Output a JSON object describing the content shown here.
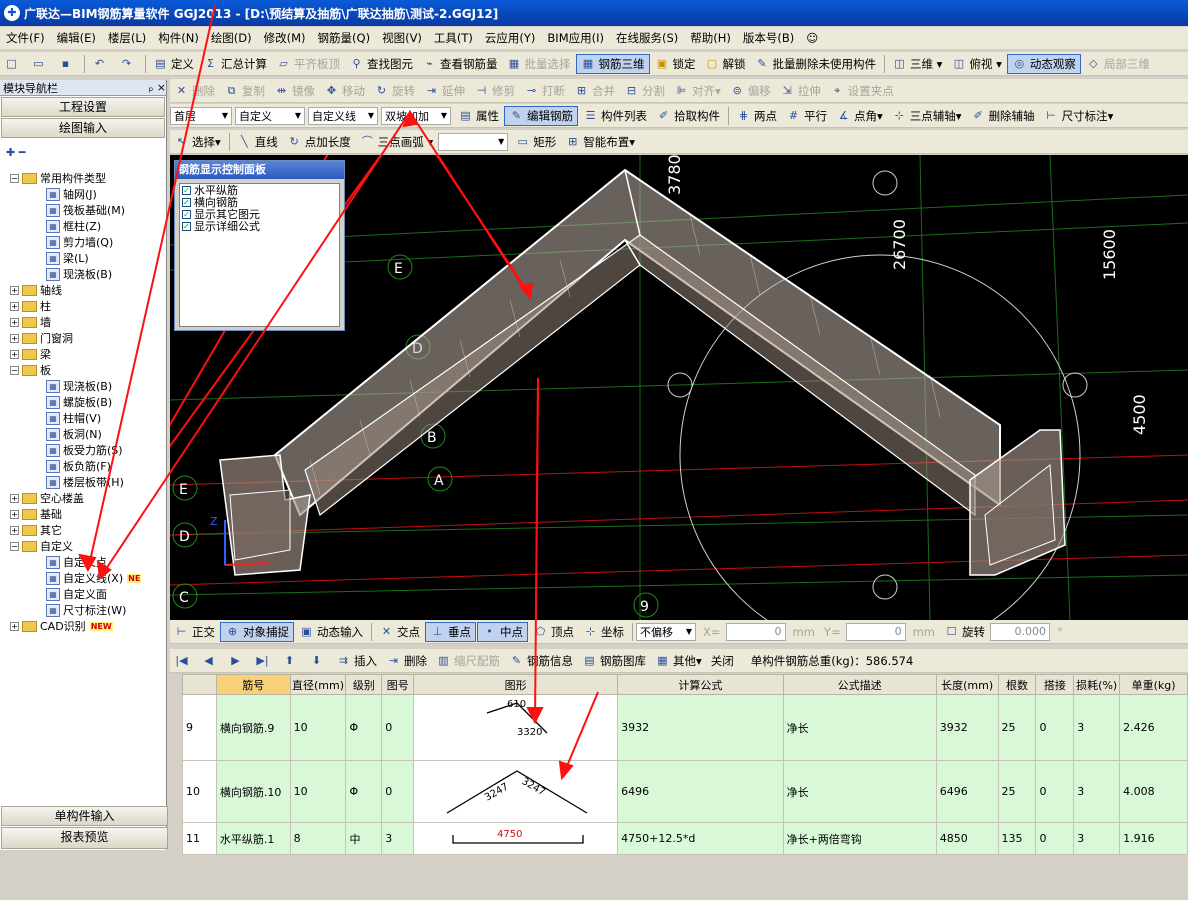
{
  "window": {
    "title": "广联达—BIM钢筋算量软件 GGJ2013 - [D:\\预结算及抽筋\\广联达抽筋\\测试-2.GGJ12]"
  },
  "menu": [
    "文件(F)",
    "编辑(E)",
    "楼层(L)",
    "构件(N)",
    "绘图(D)",
    "修改(M)",
    "钢筋量(Q)",
    "视图(V)",
    "工具(T)",
    "云应用(Y)",
    "BIM应用(I)",
    "在线服务(S)",
    "帮助(H)",
    "版本号(B)"
  ],
  "toolbar1": {
    "define": "定义",
    "sum": "汇总计算",
    "flat_top": "平齐板顶",
    "find": "查找图元",
    "view_rebar": "查看钢筋量",
    "batch_select": "批量选择",
    "rebar3d": "钢筋三维",
    "lock": "锁定",
    "unlock": "解锁",
    "batch_delete": "批量删除未使用构件",
    "view3d": "三维",
    "top_view": "俯视",
    "dynamic": "动态观察",
    "local3d": "局部三维"
  },
  "toolbar2": [
    "删除",
    "复制",
    "镜像",
    "移动",
    "旋转",
    "延伸",
    "修剪",
    "打断",
    "合并",
    "分割",
    "对齐",
    "偏移",
    "拉伸",
    "设置夹点"
  ],
  "toolbar3": {
    "floor": "首层",
    "custom": "自定义",
    "custom_line": "自定义线",
    "double_slope": "双坡加加",
    "props": "属性",
    "edit_rebar": "编辑钢筋",
    "component_list": "构件列表",
    "pick": "拾取构件",
    "two_point": "两点",
    "parallel": "平行",
    "angle": "点角",
    "three_aux": "三点辅轴",
    "del_aux": "删除辅轴",
    "dim": "尺寸标注"
  },
  "toolbar4": {
    "select": "选择",
    "line": "直线",
    "point_len": "点加长度",
    "arc": "三点画弧",
    "rect": "矩形",
    "smart": "智能布置"
  },
  "nav": {
    "title": "模块导航栏",
    "pin": "ₚ ×",
    "btn_project": "工程设置",
    "btn_draw": "绘图输入",
    "tree": [
      {
        "label": "常用构件类型",
        "level": 0,
        "expanded": true,
        "folder": true
      },
      {
        "label": "轴网(J)",
        "level": 2,
        "icon": "grid"
      },
      {
        "label": "筏板基础(M)",
        "level": 2,
        "icon": "raft"
      },
      {
        "label": "框柱(Z)",
        "level": 2,
        "icon": "column"
      },
      {
        "label": "剪力墙(Q)",
        "level": 2,
        "icon": "wall"
      },
      {
        "label": "梁(L)",
        "level": 2,
        "icon": "beam"
      },
      {
        "label": "现浇板(B)",
        "level": 2,
        "icon": "slab"
      },
      {
        "label": "轴线",
        "level": 0,
        "expanded": false,
        "folder": true
      },
      {
        "label": "柱",
        "level": 0,
        "expanded": false,
        "folder": true
      },
      {
        "label": "墙",
        "level": 0,
        "expanded": false,
        "folder": true
      },
      {
        "label": "门窗洞",
        "level": 0,
        "expanded": false,
        "folder": true
      },
      {
        "label": "梁",
        "level": 0,
        "expanded": false,
        "folder": true
      },
      {
        "label": "板",
        "level": 0,
        "expanded": true,
        "folder": true
      },
      {
        "label": "现浇板(B)",
        "level": 2,
        "icon": "slab"
      },
      {
        "label": "螺旋板(B)",
        "level": 2,
        "icon": "spiral"
      },
      {
        "label": "柱帽(V)",
        "level": 2,
        "icon": "cap"
      },
      {
        "label": "板洞(N)",
        "level": 2,
        "icon": "hole"
      },
      {
        "label": "板受力筋(S)",
        "level": 2,
        "icon": "rebar"
      },
      {
        "label": "板负筋(F)",
        "level": 2,
        "icon": "negrebar"
      },
      {
        "label": "楼层板带(H)",
        "level": 2,
        "icon": "band"
      },
      {
        "label": "空心楼盖",
        "level": 0,
        "expanded": false,
        "folder": true
      },
      {
        "label": "基础",
        "level": 0,
        "expanded": false,
        "folder": true
      },
      {
        "label": "其它",
        "level": 0,
        "expanded": false,
        "folder": true
      },
      {
        "label": "自定义",
        "level": 0,
        "expanded": true,
        "folder": true
      },
      {
        "label": "自定义点",
        "level": 2,
        "icon": "point"
      },
      {
        "label": "自定义线(X)",
        "level": 2,
        "icon": "line",
        "badge": "NE"
      },
      {
        "label": "自定义面",
        "level": 2,
        "icon": "face"
      },
      {
        "label": "尺寸标注(W)",
        "level": 2,
        "icon": "dim"
      },
      {
        "label": "CAD识别",
        "level": 0,
        "expanded": false,
        "folder": true,
        "badge": "NEW"
      }
    ],
    "btn_single": "单构件输入",
    "btn_report": "报表预览"
  },
  "panel": {
    "title": "钢筋显示控制面板",
    "items": [
      "水平纵筋",
      "横向钢筋",
      "显示其它图元",
      "显示详细公式"
    ]
  },
  "viewport": {
    "axes": [
      "E",
      "D",
      "B",
      "A",
      "E",
      "D",
      "C",
      "9"
    ],
    "dims": [
      "3780",
      "26700",
      "15600",
      "4500"
    ]
  },
  "statusbar": {
    "ortho": "正交",
    "snap": "对象捕捉",
    "dyn_input": "动态输入",
    "intersect": "交点",
    "perp": "垂点",
    "mid": "中点",
    "vertex": "顶点",
    "coord": "坐标",
    "offset": "不偏移",
    "x_label": "X=",
    "x_val": "0",
    "y_label": "Y=",
    "y_val": "0",
    "mm": "mm",
    "rotate": "旋转",
    "rot_val": "0.000",
    "deg": "°"
  },
  "gridbar": {
    "insert": "插入",
    "delete": "删除",
    "scale": "缩尺配筋",
    "info": "钢筋信息",
    "lib": "钢筋图库",
    "other": "其他",
    "close": "关闭",
    "total": "单构件钢筋总重(kg)：586.574"
  },
  "table": {
    "headers": [
      "筋号",
      "直径(mm)",
      "级别",
      "图号",
      "图形",
      "计算公式",
      "公式描述",
      "长度(mm)",
      "根数",
      "搭接",
      "损耗(%)",
      "单重(kg)"
    ],
    "rows": [
      {
        "no": "9",
        "name": "横向钢筋.9",
        "dia": "10",
        "grade": "Φ",
        "fig": "0",
        "shape_a": "610",
        "shape_b": "3320",
        "formula": "3932",
        "desc": "净长",
        "len": "3932",
        "count": "25",
        "lap": "0",
        "loss": "3",
        "weight": "2.426"
      },
      {
        "no": "10",
        "name": "横向钢筋.10",
        "dia": "10",
        "grade": "Φ",
        "fig": "0",
        "shape_a": "3247",
        "shape_b": "3247",
        "formula": "6496",
        "desc": "净长",
        "len": "6496",
        "count": "25",
        "lap": "0",
        "loss": "3",
        "weight": "4.008"
      },
      {
        "no": "11",
        "name": "水平纵筋.1",
        "dia": "8",
        "grade": "中",
        "fig": "3",
        "shape_a": "4750",
        "shape_b": "",
        "formula": "4750+12.5*d",
        "desc": "净长+两倍弯钩",
        "len": "4850",
        "count": "135",
        "lap": "0",
        "loss": "3",
        "weight": "1.916"
      }
    ]
  }
}
